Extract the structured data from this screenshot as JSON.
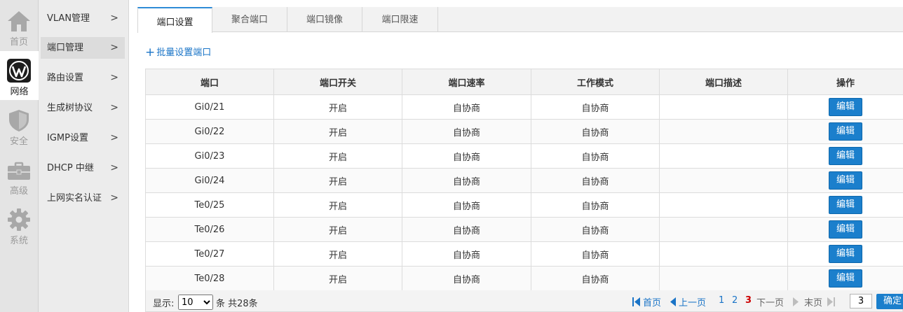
{
  "rail": [
    {
      "label": "首页",
      "icon": "home-icon"
    },
    {
      "label": "网络",
      "icon": "wordpress-icon",
      "active": true
    },
    {
      "label": "安全",
      "icon": "shield-icon"
    },
    {
      "label": "高级",
      "icon": "briefcase-icon"
    },
    {
      "label": "系统",
      "icon": "gear-icon"
    }
  ],
  "submenu": [
    {
      "label": "VLAN管理",
      "chevron": ">"
    },
    {
      "label": "端口管理",
      "chevron": ">",
      "active": true
    },
    {
      "label": "路由设置",
      "chevron": ">"
    },
    {
      "label": "生成树协议",
      "chevron": ">"
    },
    {
      "label": "IGMP设置",
      "chevron": ">"
    },
    {
      "label": "DHCP 中继",
      "chevron": ">"
    },
    {
      "label": "上网实名认证",
      "chevron": ">"
    }
  ],
  "tabs": [
    {
      "label": "端口设置",
      "active": true
    },
    {
      "label": "聚合端口"
    },
    {
      "label": "端口镜像"
    },
    {
      "label": "端口限速"
    }
  ],
  "batch_link": {
    "icon": "plus-icon",
    "label": "批量设置端口"
  },
  "table": {
    "columns": [
      "端口",
      "端口开关",
      "端口速率",
      "工作模式",
      "端口描述",
      "操作"
    ],
    "rows": [
      {
        "port": "Gi0/21",
        "switch": "开启",
        "speed": "自协商",
        "mode": "自协商",
        "desc": "",
        "action": "编辑"
      },
      {
        "port": "Gi0/22",
        "switch": "开启",
        "speed": "自协商",
        "mode": "自协商",
        "desc": "",
        "action": "编辑"
      },
      {
        "port": "Gi0/23",
        "switch": "开启",
        "speed": "自协商",
        "mode": "自协商",
        "desc": "",
        "action": "编辑"
      },
      {
        "port": "Gi0/24",
        "switch": "开启",
        "speed": "自协商",
        "mode": "自协商",
        "desc": "",
        "action": "编辑"
      },
      {
        "port": "Te0/25",
        "switch": "开启",
        "speed": "自协商",
        "mode": "自协商",
        "desc": "",
        "action": "编辑"
      },
      {
        "port": "Te0/26",
        "switch": "开启",
        "speed": "自协商",
        "mode": "自协商",
        "desc": "",
        "action": "编辑"
      },
      {
        "port": "Te0/27",
        "switch": "开启",
        "speed": "自协商",
        "mode": "自协商",
        "desc": "",
        "action": "编辑"
      },
      {
        "port": "Te0/28",
        "switch": "开启",
        "speed": "自协商",
        "mode": "自协商",
        "desc": "",
        "action": "编辑"
      }
    ]
  },
  "footer": {
    "show_label": "显示:",
    "page_size": "10",
    "total_text": "条 共28条",
    "first": "首页",
    "prev": "上一页",
    "pages": [
      "1",
      "2",
      "3"
    ],
    "current_page": "3",
    "next": "下一页",
    "last": "末页",
    "jump_value": "3",
    "ok": "确定"
  },
  "colors": {
    "accent": "#1b7fcc",
    "link": "#1a74c7",
    "current_page": "#cc0000",
    "rail_bg": "#e4e4e4",
    "submenu_bg": "#ececec"
  }
}
